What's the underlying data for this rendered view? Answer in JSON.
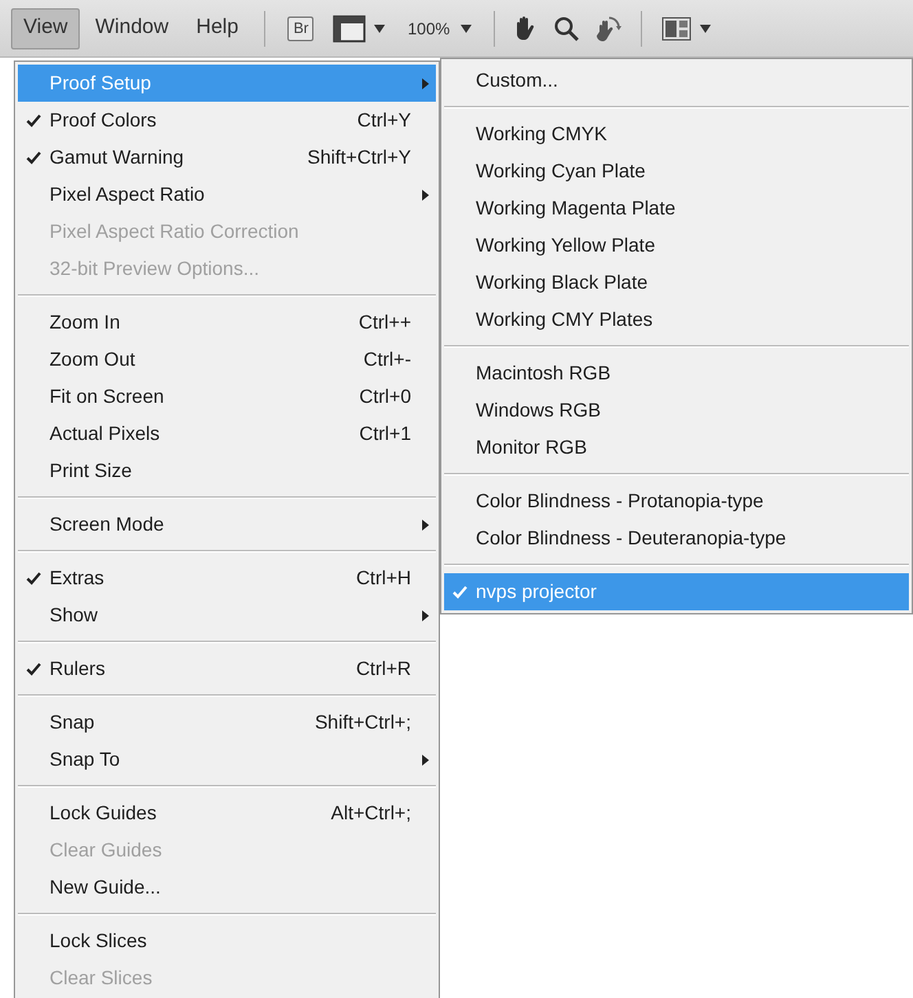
{
  "menubar": [
    {
      "label": "View",
      "selected": true
    },
    {
      "label": "Window",
      "selected": false
    },
    {
      "label": "Help",
      "selected": false
    }
  ],
  "toolbar": {
    "bridge_label": "Br",
    "zoom_value": "100%"
  },
  "view_menu": {
    "sections": [
      [
        {
          "label": "Proof Setup",
          "checked": false,
          "disabled": false,
          "submenu": true,
          "selected": true
        },
        {
          "label": "Proof Colors",
          "shortcut": "Ctrl+Y",
          "checked": true,
          "disabled": false,
          "submenu": false,
          "selected": false
        },
        {
          "label": "Gamut Warning",
          "shortcut": "Shift+Ctrl+Y",
          "checked": true,
          "disabled": false,
          "submenu": false,
          "selected": false
        },
        {
          "label": "Pixel Aspect Ratio",
          "checked": false,
          "disabled": false,
          "submenu": true,
          "selected": false
        },
        {
          "label": "Pixel Aspect Ratio Correction",
          "checked": false,
          "disabled": true,
          "submenu": false,
          "selected": false
        },
        {
          "label": "32-bit Preview Options...",
          "checked": false,
          "disabled": true,
          "submenu": false,
          "selected": false
        }
      ],
      [
        {
          "label": "Zoom In",
          "shortcut": "Ctrl++",
          "checked": false,
          "disabled": false,
          "submenu": false,
          "selected": false
        },
        {
          "label": "Zoom Out",
          "shortcut": "Ctrl+-",
          "checked": false,
          "disabled": false,
          "submenu": false,
          "selected": false
        },
        {
          "label": "Fit on Screen",
          "shortcut": "Ctrl+0",
          "checked": false,
          "disabled": false,
          "submenu": false,
          "selected": false
        },
        {
          "label": "Actual Pixels",
          "shortcut": "Ctrl+1",
          "checked": false,
          "disabled": false,
          "submenu": false,
          "selected": false
        },
        {
          "label": "Print Size",
          "checked": false,
          "disabled": false,
          "submenu": false,
          "selected": false
        }
      ],
      [
        {
          "label": "Screen Mode",
          "checked": false,
          "disabled": false,
          "submenu": true,
          "selected": false
        }
      ],
      [
        {
          "label": "Extras",
          "shortcut": "Ctrl+H",
          "checked": true,
          "disabled": false,
          "submenu": false,
          "selected": false
        },
        {
          "label": "Show",
          "checked": false,
          "disabled": false,
          "submenu": true,
          "selected": false
        }
      ],
      [
        {
          "label": "Rulers",
          "shortcut": "Ctrl+R",
          "checked": true,
          "disabled": false,
          "submenu": false,
          "selected": false
        }
      ],
      [
        {
          "label": "Snap",
          "shortcut": "Shift+Ctrl+;",
          "checked": false,
          "disabled": false,
          "submenu": false,
          "selected": false
        },
        {
          "label": "Snap To",
          "checked": false,
          "disabled": false,
          "submenu": true,
          "selected": false
        }
      ],
      [
        {
          "label": "Lock Guides",
          "shortcut": "Alt+Ctrl+;",
          "checked": false,
          "disabled": false,
          "submenu": false,
          "selected": false
        },
        {
          "label": "Clear Guides",
          "checked": false,
          "disabled": true,
          "submenu": false,
          "selected": false
        },
        {
          "label": "New Guide...",
          "checked": false,
          "disabled": false,
          "submenu": false,
          "selected": false
        }
      ],
      [
        {
          "label": "Lock Slices",
          "checked": false,
          "disabled": false,
          "submenu": false,
          "selected": false
        },
        {
          "label": "Clear Slices",
          "checked": false,
          "disabled": true,
          "submenu": false,
          "selected": false
        }
      ]
    ]
  },
  "proof_setup_submenu": {
    "sections": [
      [
        {
          "label": "Custom...",
          "checked": false,
          "selected": false
        }
      ],
      [
        {
          "label": "Working CMYK",
          "checked": false,
          "selected": false
        },
        {
          "label": "Working Cyan Plate",
          "checked": false,
          "selected": false
        },
        {
          "label": "Working Magenta Plate",
          "checked": false,
          "selected": false
        },
        {
          "label": "Working Yellow Plate",
          "checked": false,
          "selected": false
        },
        {
          "label": "Working Black Plate",
          "checked": false,
          "selected": false
        },
        {
          "label": "Working CMY Plates",
          "checked": false,
          "selected": false
        }
      ],
      [
        {
          "label": "Macintosh RGB",
          "checked": false,
          "selected": false
        },
        {
          "label": "Windows RGB",
          "checked": false,
          "selected": false
        },
        {
          "label": "Monitor RGB",
          "checked": false,
          "selected": false
        }
      ],
      [
        {
          "label": "Color Blindness - Protanopia-type",
          "checked": false,
          "selected": false
        },
        {
          "label": "Color Blindness - Deuteranopia-type",
          "checked": false,
          "selected": false
        }
      ],
      [
        {
          "label": "nvps projector",
          "checked": true,
          "selected": true
        }
      ]
    ]
  }
}
